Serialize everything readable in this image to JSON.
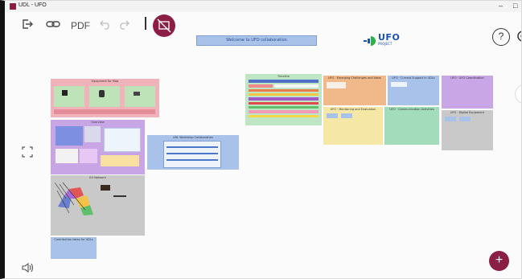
{
  "window": {
    "title": "UDL - UFO"
  },
  "toolbar": {
    "pdf_label": "PDF",
    "icons": [
      "exit-icon",
      "link-icon",
      "undo-icon",
      "redo-icon",
      "record-icon"
    ]
  },
  "board": {
    "title_box_text": "Welcome to UFO collaboration",
    "logo_text": "UFO",
    "logo_subtext": "PROJECT"
  },
  "frames": {
    "equipment": "Equipment for Map",
    "overview": "Overview",
    "udl_workshop": "UDL Workshop Collaboration",
    "timeline": "Timeline",
    "emerging": "UFO · Emerging Challenges and Ideas",
    "current_support": "UFO · Current Support in UDLs",
    "coordination": "UFO · UFO Coordination",
    "monitoring": "UFO · Monitoring and Evaluation",
    "communication": "UFO · Communication Activities",
    "digital_equipment": "UFO · Digital Equipment",
    "eu_network": "EU Network",
    "contribution": "Contribution ideas for UDLs"
  },
  "side_buttons": {
    "help": "?",
    "add": "+"
  },
  "colors": {
    "accent": "#8b1e44",
    "brand_blue": "#1f53a8"
  }
}
